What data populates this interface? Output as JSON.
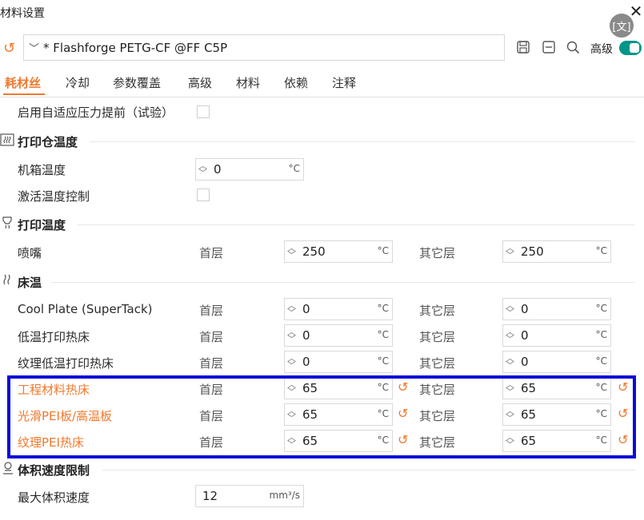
{
  "window": {
    "title": "材料设置",
    "close_symbol": "✕"
  },
  "toolbar": {
    "preset_name": "* Flashforge PETG-CF @FF C5P",
    "advanced_label": "高级",
    "advanced_on": true,
    "scan_icon_text": "[文]"
  },
  "tabs": [
    "耗材丝",
    "冷却",
    "参数覆盖",
    "高级",
    "材料",
    "依赖",
    "注释"
  ],
  "active_tab": "耗材丝",
  "rows": {
    "adaptive_pa": "启用自适应压力提前（试验）",
    "chamber_section": "打印仓温度",
    "chamber_temp_label": "机箱温度",
    "chamber_temp_value": "0",
    "activate_temp_control": "激活温度控制",
    "print_temp_section": "打印温度",
    "nozzle_label": "喷嘴",
    "bed_section": "床温",
    "volumetric_section": "体积速度限制",
    "max_volumetric_label": "最大体积速度",
    "max_volumetric_value": "12",
    "max_volumetric_unit": "mm³/s"
  },
  "common": {
    "first_layer": "首层",
    "other_layers": "其它层",
    "unit_c": "°C"
  },
  "nozzle": {
    "first": "250",
    "other": "250"
  },
  "beds": [
    {
      "name": "Cool Plate (SuperTack)",
      "first": "0",
      "other": "0",
      "modified": false
    },
    {
      "name": "低温打印热床",
      "first": "0",
      "other": "0",
      "modified": false
    },
    {
      "name": "纹理低温打印热床",
      "first": "0",
      "other": "0",
      "modified": false
    },
    {
      "name": "工程材料热床",
      "first": "65",
      "other": "65",
      "modified": true
    },
    {
      "name": "光滑PEI板/高温板",
      "first": "65",
      "other": "65",
      "modified": true
    },
    {
      "name": "纹理PEI热床",
      "first": "65",
      "other": "65",
      "modified": true
    }
  ],
  "colors": {
    "accent": "#f0782d",
    "toggle": "#009688",
    "highlight": "#0b0bd9"
  }
}
